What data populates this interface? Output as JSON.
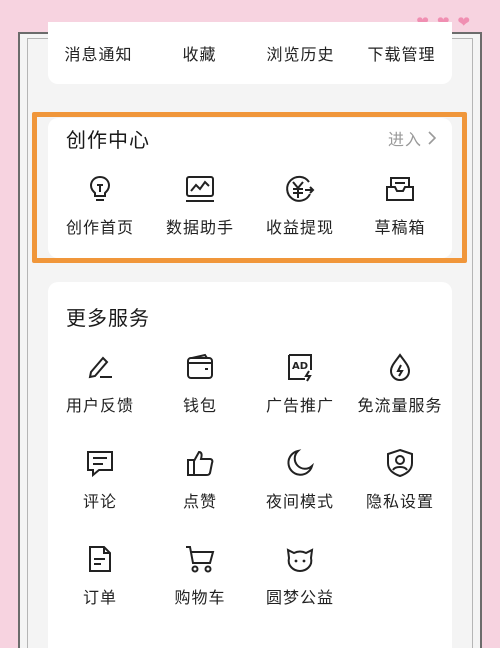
{
  "top_row": [
    "消息通知",
    "收藏",
    "浏览历史",
    "下载管理"
  ],
  "creation_center": {
    "title": "创作中心",
    "enter_label": "进入",
    "items": [
      {
        "label": "创作首页",
        "icon": "lightbulb-icon"
      },
      {
        "label": "数据助手",
        "icon": "chart-icon"
      },
      {
        "label": "收益提现",
        "icon": "yuan-withdraw-icon"
      },
      {
        "label": "草稿箱",
        "icon": "inbox-icon"
      }
    ]
  },
  "more_services": {
    "title": "更多服务",
    "items": [
      {
        "label": "用户反馈",
        "icon": "pencil-icon"
      },
      {
        "label": "钱包",
        "icon": "wallet-icon"
      },
      {
        "label": "广告推广",
        "icon": "ad-icon"
      },
      {
        "label": "免流量服务",
        "icon": "data-drop-icon"
      },
      {
        "label": "评论",
        "icon": "comment-icon"
      },
      {
        "label": "点赞",
        "icon": "thumbs-up-icon"
      },
      {
        "label": "夜间模式",
        "icon": "moon-icon"
      },
      {
        "label": "隐私设置",
        "icon": "shield-user-icon"
      },
      {
        "label": "订单",
        "icon": "order-icon"
      },
      {
        "label": "购物车",
        "icon": "cart-icon"
      },
      {
        "label": "圆梦公益",
        "icon": "charity-cat-icon"
      }
    ]
  },
  "colors": {
    "background": "#f7d3e0",
    "highlight_border": "#f0963a",
    "hearts": "#f08fb2"
  }
}
